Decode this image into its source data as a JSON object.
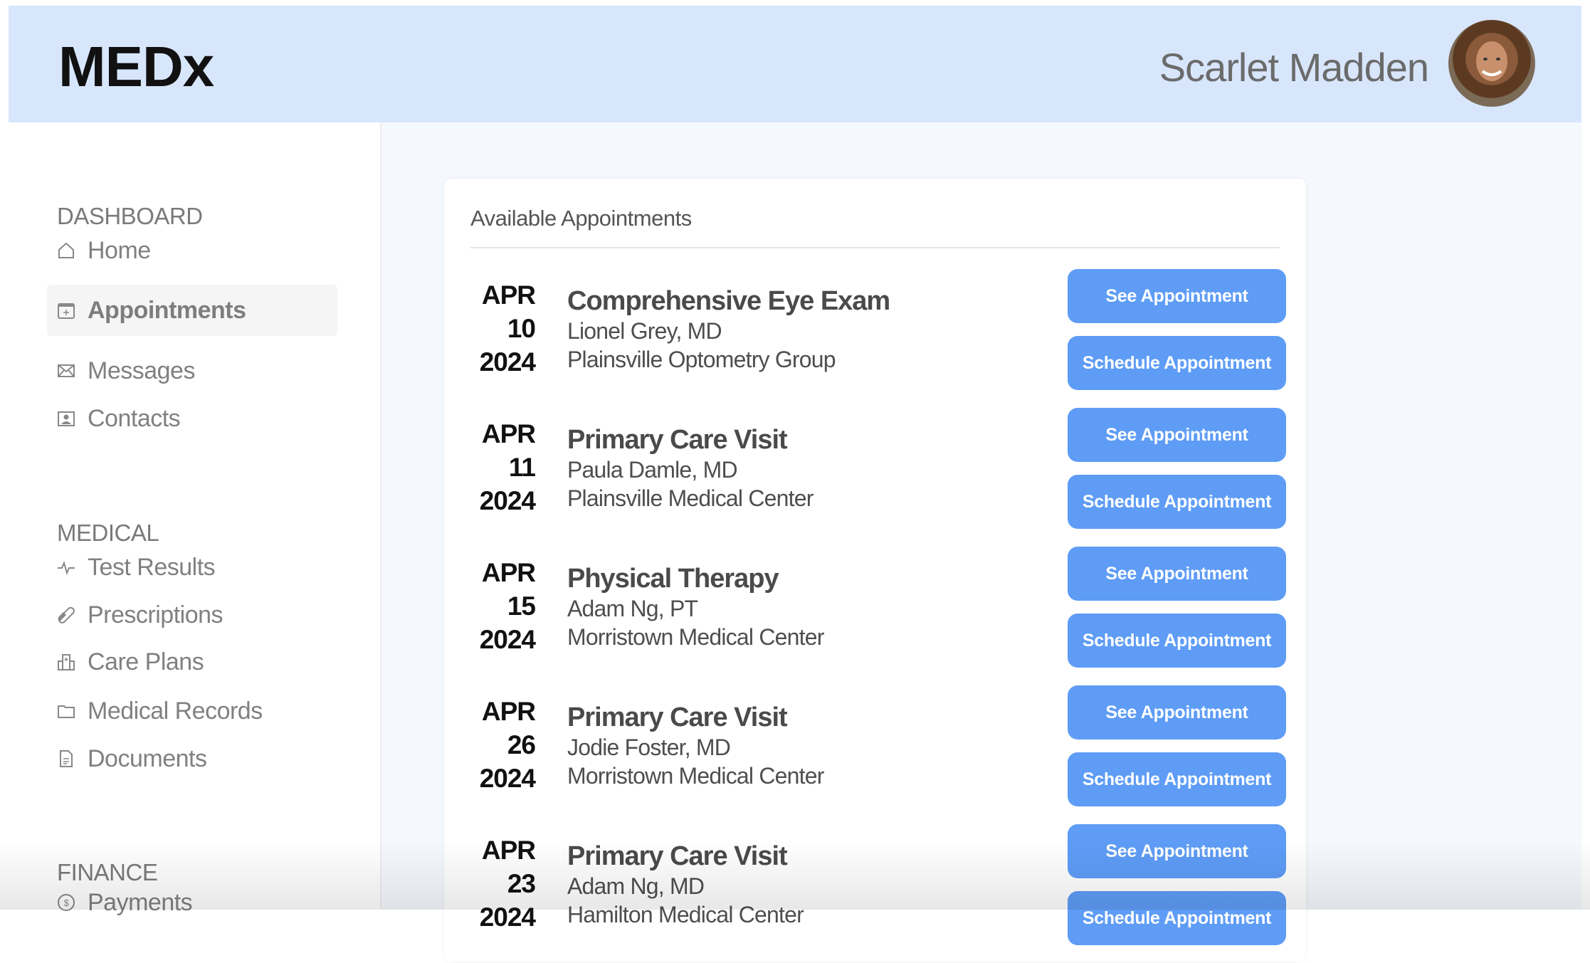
{
  "header": {
    "logo": "MEDx",
    "user_name": "Scarlet Madden"
  },
  "sidebar": {
    "sections": [
      {
        "title": "DASHBOARD",
        "items": [
          {
            "label": "Home",
            "icon": "home-icon"
          },
          {
            "label": "Appointments",
            "icon": "calendar-plus-icon",
            "active": true
          },
          {
            "label": "Messages",
            "icon": "envelope-icon"
          },
          {
            "label": "Contacts",
            "icon": "contact-card-icon"
          }
        ]
      },
      {
        "title": "MEDICAL",
        "items": [
          {
            "label": "Test Results",
            "icon": "pulse-icon"
          },
          {
            "label": "Prescriptions",
            "icon": "pill-icon"
          },
          {
            "label": "Care Plans",
            "icon": "hospital-icon"
          },
          {
            "label": "Medical Records",
            "icon": "folder-icon"
          },
          {
            "label": "Documents",
            "icon": "document-icon"
          }
        ]
      },
      {
        "title": "FINANCE",
        "items": [
          {
            "label": "Payments",
            "icon": "dollar-coin-icon"
          }
        ]
      }
    ]
  },
  "appointments": {
    "title": "Available Appointments",
    "see_label": "See Appointment",
    "schedule_label": "Schedule Appointment",
    "items": [
      {
        "month": "APR",
        "day": "10",
        "year": "2024",
        "title": "Comprehensive Eye Exam",
        "doctor": "Lionel Grey, MD",
        "location": "Plainsville Optometry Group"
      },
      {
        "month": "APR",
        "day": "11",
        "year": "2024",
        "title": "Primary Care Visit",
        "doctor": "Paula Damle, MD",
        "location": "Plainsville Medical Center"
      },
      {
        "month": "APR",
        "day": "15",
        "year": "2024",
        "title": "Physical Therapy",
        "doctor": "Adam Ng, PT",
        "location": "Morristown Medical Center"
      },
      {
        "month": "APR",
        "day": "26",
        "year": "2024",
        "title": "Primary Care Visit",
        "doctor": "Jodie Foster, MD",
        "location": "Morristown Medical Center"
      },
      {
        "month": "APR",
        "day": "23",
        "year": "2024",
        "title": "Primary Care Visit",
        "doctor": "Adam Ng, MD",
        "location": "Hamilton Medical Center"
      }
    ]
  },
  "colors": {
    "header_bg": "#d8e6fc",
    "button": "#5e9cf6",
    "main_bg": "#f5f8fd"
  }
}
